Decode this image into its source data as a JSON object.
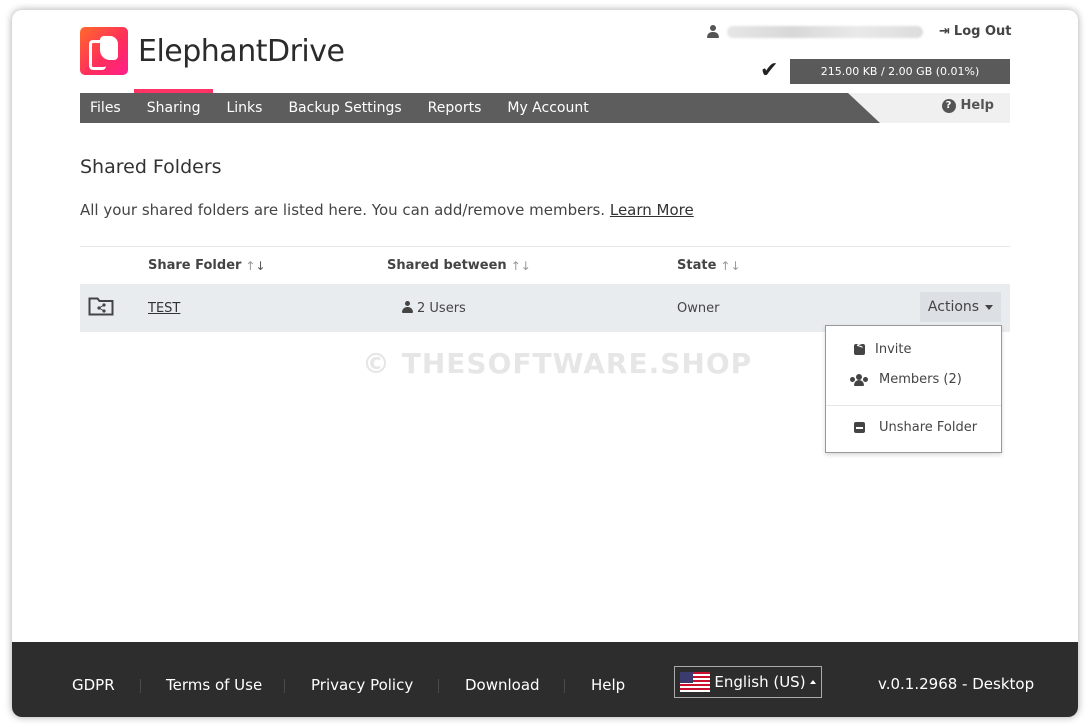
{
  "header": {
    "brand_name": "ElephantDrive",
    "logout_label": "Log Out",
    "storage_usage": "215.00 KB / 2.00 GB (0.01%)",
    "help_label": "Help"
  },
  "nav": {
    "items": [
      {
        "label": "Files"
      },
      {
        "label": "Sharing"
      },
      {
        "label": "Links"
      },
      {
        "label": "Backup Settings"
      },
      {
        "label": "Reports"
      },
      {
        "label": "My Account"
      }
    ],
    "active_index": 1
  },
  "main": {
    "title": "Shared Folders",
    "intro_text": "All your shared folders are listed here. You can add/remove members.",
    "learn_more": "Learn More",
    "table": {
      "columns": [
        "Share Folder",
        "Shared between",
        "State"
      ],
      "rows": [
        {
          "folder": "TEST",
          "shared_between": "2 Users",
          "state": "Owner",
          "actions_label": "Actions"
        }
      ]
    },
    "actions_menu": {
      "items": [
        {
          "label": "Invite",
          "icon": "share-icon"
        },
        {
          "label": "Members (2)",
          "icon": "users-icon"
        },
        {
          "label": "Unshare Folder",
          "icon": "minus-square-icon"
        }
      ]
    },
    "watermark": "© THESOFTWARE.SHOP"
  },
  "footer": {
    "links": [
      "GDPR",
      "Terms of Use",
      "Privacy Policy",
      "Download",
      "Help"
    ],
    "language": "English (US)",
    "version": "v.0.1.2968 - Desktop"
  },
  "colors": {
    "nav_bg": "#5d5d5d",
    "accent": "#ff3366",
    "footer_bg": "#2d2d2d",
    "row_bg": "#e9ecef"
  }
}
